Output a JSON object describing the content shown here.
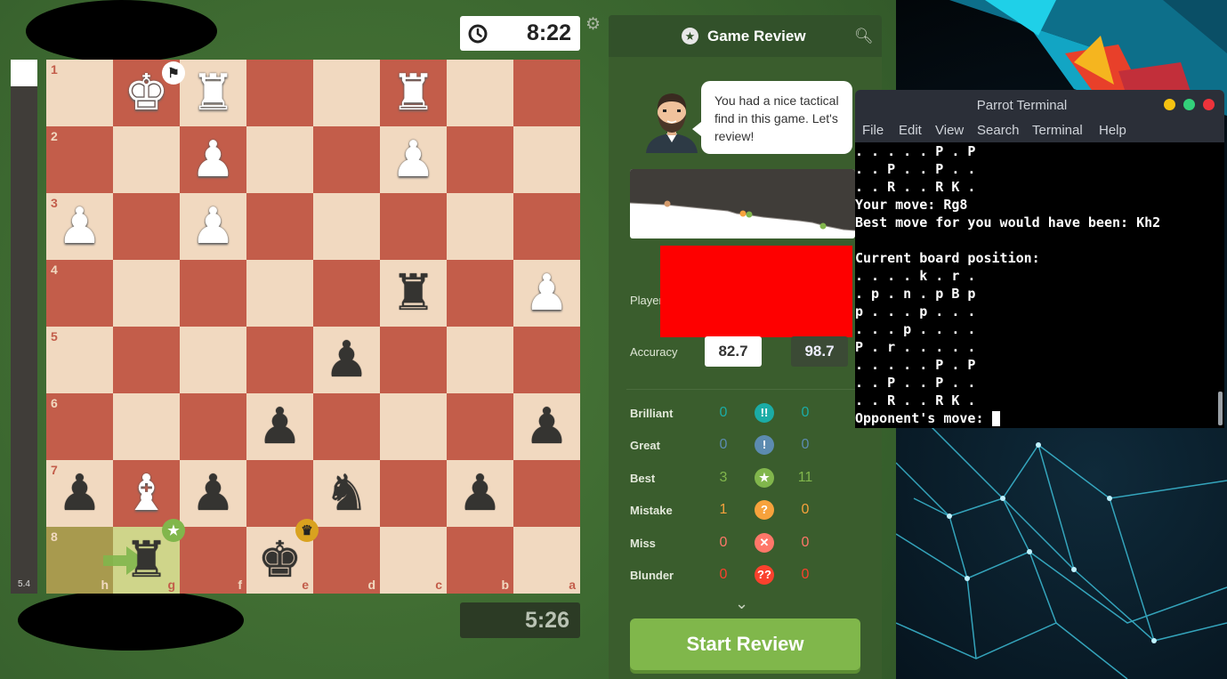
{
  "top_clock": "8:22",
  "bottom_clock": "5:26",
  "eval_value": "5.4",
  "board": {
    "ranks": [
      "1",
      "2",
      "3",
      "4",
      "5",
      "6",
      "7",
      "8"
    ],
    "files": [
      "h",
      "g",
      "f",
      "e",
      "d",
      "c",
      "b",
      "a"
    ],
    "pieces": [
      {
        "sq": "g1",
        "p": "♚",
        "c": "w"
      },
      {
        "sq": "f1",
        "p": "♜",
        "c": "w"
      },
      {
        "sq": "c1",
        "p": "♜",
        "c": "w"
      },
      {
        "sq": "f2",
        "p": "♟",
        "c": "w"
      },
      {
        "sq": "c2",
        "p": "♟",
        "c": "w"
      },
      {
        "sq": "h3",
        "p": "♟",
        "c": "w"
      },
      {
        "sq": "f3",
        "p": "♟",
        "c": "w"
      },
      {
        "sq": "c4",
        "p": "♜",
        "c": "b"
      },
      {
        "sq": "a4",
        "p": "♟",
        "c": "w"
      },
      {
        "sq": "d5",
        "p": "♟",
        "c": "b"
      },
      {
        "sq": "e6",
        "p": "♟",
        "c": "b"
      },
      {
        "sq": "a6",
        "p": "♟",
        "c": "b"
      },
      {
        "sq": "h7",
        "p": "♟",
        "c": "b"
      },
      {
        "sq": "g7",
        "p": "♝",
        "c": "w"
      },
      {
        "sq": "f7",
        "p": "♟",
        "c": "b"
      },
      {
        "sq": "d7",
        "p": "♞",
        "c": "b"
      },
      {
        "sq": "b7",
        "p": "♟",
        "c": "b"
      },
      {
        "sq": "g8",
        "p": "♜",
        "c": "b"
      },
      {
        "sq": "e8",
        "p": "♚",
        "c": "b"
      }
    ]
  },
  "panel": {
    "title": "Game Review",
    "coach_message": "You had a nice tactical find in this game. Let's review!",
    "players_label": "Players",
    "accuracy_label": "Accuracy",
    "accuracy_white": "82.7",
    "accuracy_black": "98.7",
    "rows": [
      {
        "label": "Brilliant",
        "w": "0",
        "b": "0",
        "icon": "!!",
        "color": "#1baca6"
      },
      {
        "label": "Great",
        "w": "0",
        "b": "0",
        "icon": "!",
        "color": "#5c8bb0"
      },
      {
        "label": "Best",
        "w": "3",
        "b": "11",
        "icon": "★",
        "color": "#81b64c"
      },
      {
        "label": "Mistake",
        "w": "1",
        "b": "0",
        "icon": "?",
        "color": "#f7a23c"
      },
      {
        "label": "Miss",
        "w": "0",
        "b": "0",
        "icon": "✕",
        "color": "#ff7769"
      },
      {
        "label": "Blunder",
        "w": "0",
        "b": "0",
        "icon": "??",
        "color": "#fa412d"
      }
    ],
    "start_button": "Start Review"
  },
  "terminal": {
    "title": "Parrot Terminal",
    "menu": [
      "File",
      "Edit",
      "View",
      "Search",
      "Terminal",
      "Help"
    ],
    "lines": [
      ". . . . . P . P",
      ". . P . . P . .",
      ". . R . . R K .",
      "Your move: Rg8",
      "Best move for you would have been: Kh2",
      "",
      "Current board position:",
      ". . . . k . r .",
      ". p . n . p B p",
      "p . . . p . . .",
      ". . . p . . . .",
      "P . r . . . . .",
      ". . . . . P . P",
      ". . P . . P . .",
      ". . R . . R K ."
    ],
    "prompt": "Opponent's move: "
  }
}
